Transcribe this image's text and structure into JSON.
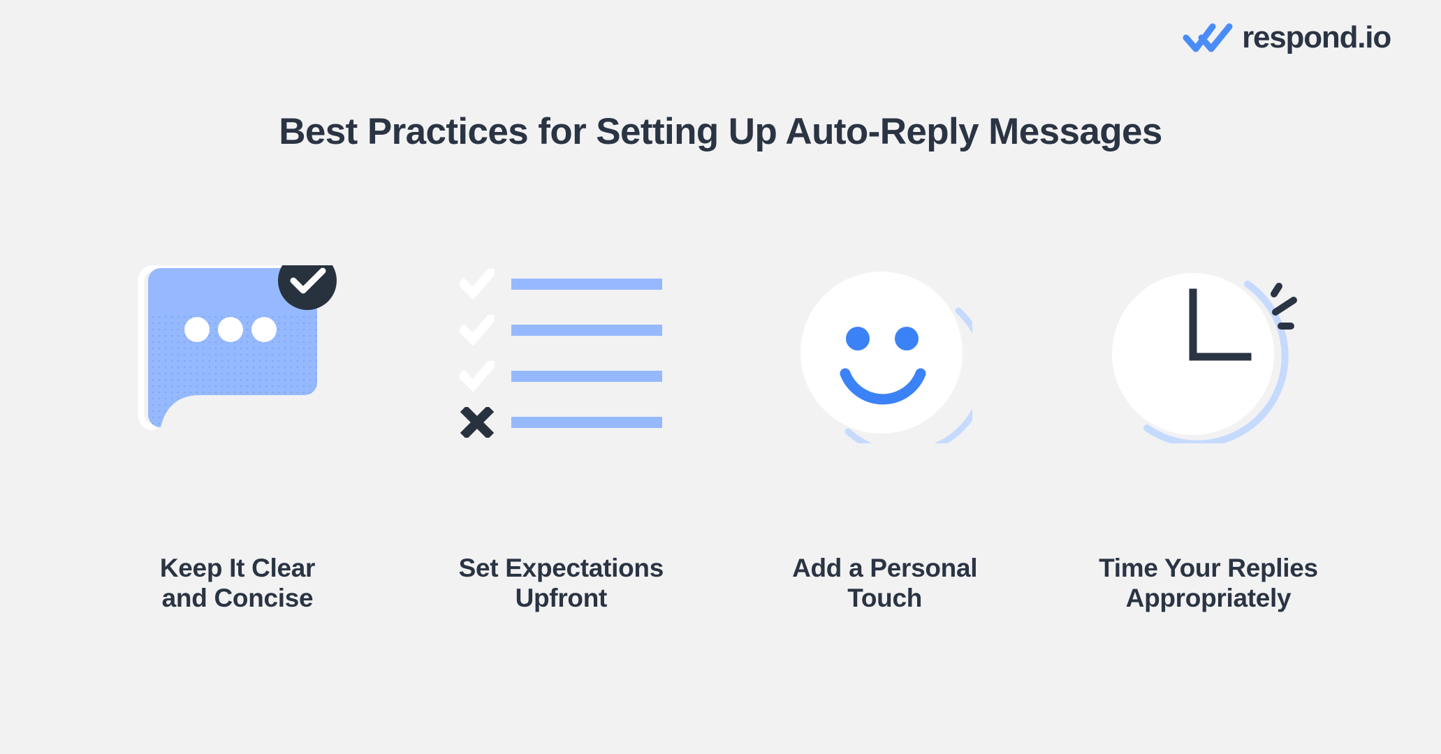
{
  "brand": {
    "logo_icon": "double-check-icon",
    "logo_text": "respond.io",
    "logo_blue": "#4A8CF7",
    "logo_dark": "#2A3443"
  },
  "header": {
    "title": "Best Practices for Setting Up Auto-Reply Messages"
  },
  "theme": {
    "background": "#F2F2F3",
    "text_dark": "#2A3443",
    "blue_light": "#96B9FD",
    "blue_accent": "#3B82F6",
    "blue_pale": "#C6DAFE",
    "badge_dark": "#28323F",
    "white": "#FFFFFF"
  },
  "items": [
    {
      "icon": "speech-bubble-check-icon",
      "icon_parts": [
        "speech-bubble",
        "typing-dots",
        "check-badge"
      ],
      "label_line1": "Keep It Clear",
      "label_line2": "and Concise"
    },
    {
      "icon": "checklist-icon",
      "icon_parts": [
        "check-mark",
        "check-mark",
        "check-mark",
        "cross-mark"
      ],
      "rows": [
        "check",
        "check",
        "check",
        "cross"
      ],
      "label_line1": "Set Expectations",
      "label_line2": "Upfront"
    },
    {
      "icon": "smiley-face-icon",
      "icon_parts": [
        "left-eye",
        "right-eye",
        "smile",
        "arc-outline"
      ],
      "label_line1": "Add a Personal",
      "label_line2": "Touch"
    },
    {
      "icon": "clock-icon",
      "icon_parts": [
        "hour-hand",
        "minute-hand",
        "arc-outline",
        "alarm-marks"
      ],
      "label_line1": "Time Your Replies",
      "label_line2": "Appropriately"
    }
  ]
}
